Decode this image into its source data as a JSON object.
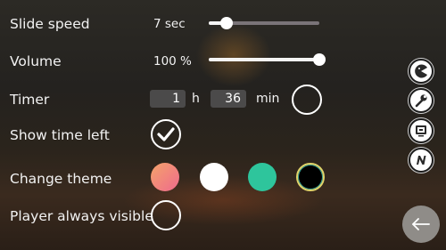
{
  "settings": {
    "slide_speed": {
      "label": "Slide speed",
      "value": "7 sec",
      "level": 0.16
    },
    "volume": {
      "label": "Volume",
      "value": "100 %",
      "level": 1.0
    },
    "timer": {
      "label": "Timer",
      "hours": "1",
      "hours_unit": "h",
      "minutes": "36",
      "minutes_unit": "min",
      "enabled": false
    },
    "show_time_left": {
      "label": "Show time left",
      "checked": true
    },
    "change_theme": {
      "label": "Change theme",
      "swatches": [
        {
          "name": "coral-gradient",
          "colors": [
            "#f49a6c",
            "#f06a8e"
          ]
        },
        {
          "name": "white",
          "colors": [
            "#ffffff"
          ]
        },
        {
          "name": "teal",
          "colors": [
            "#2ec59c"
          ]
        },
        {
          "name": "black",
          "colors": [
            "#000000"
          ]
        }
      ]
    },
    "player_always_visible": {
      "label": "Player always visible",
      "checked": false
    }
  },
  "side_icons": [
    "pacman-icon",
    "wrench-icon",
    "device-screen-icon",
    "n-logo-icon"
  ],
  "back_button": {
    "icon": "arrow-left-icon"
  },
  "colors": {
    "track": "#7a7478",
    "fill": "#f4f4f4",
    "back_button": "#8f8c88"
  }
}
